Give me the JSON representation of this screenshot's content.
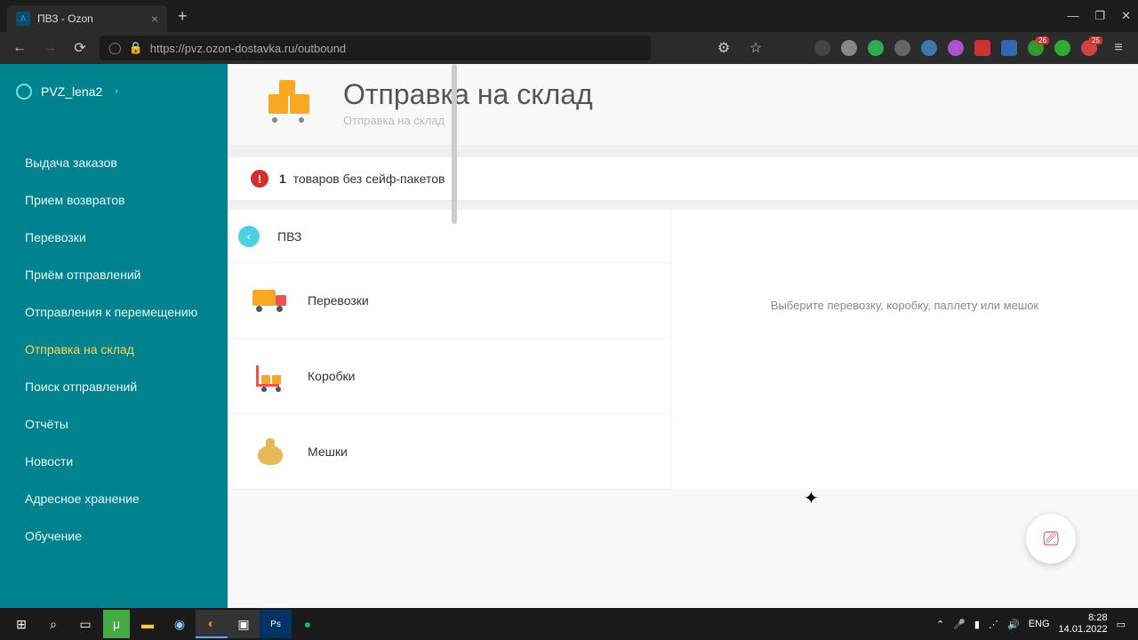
{
  "browser": {
    "tab_title": "ПВЗ - Ozon",
    "url": "https://pvz.ozon-dostavka.ru/outbound"
  },
  "sidebar": {
    "brand": "PVZ_lena2",
    "items": [
      {
        "label": "Выдача заказов",
        "active": false
      },
      {
        "label": "Прием возвратов",
        "active": false
      },
      {
        "label": "Перевозки",
        "active": false
      },
      {
        "label": "Приём отправлений",
        "active": false
      },
      {
        "label": "Отправления к перемещению",
        "active": false
      },
      {
        "label": "Отправка на склад",
        "active": true
      },
      {
        "label": "Поиск отправлений",
        "active": false
      },
      {
        "label": "Отчёты",
        "active": false
      },
      {
        "label": "Новости",
        "active": false
      },
      {
        "label": "Адресное хранение",
        "active": false
      },
      {
        "label": "Обучение",
        "active": false
      }
    ]
  },
  "page": {
    "title": "Отправка на склад",
    "subtitle": "Отправка на склад"
  },
  "alert": {
    "count": "1",
    "text": "товаров без сейф-пакетов"
  },
  "panel": {
    "back": "ПВЗ",
    "items": [
      {
        "label": "Перевозки"
      },
      {
        "label": "Коробки"
      },
      {
        "label": "Мешки"
      }
    ]
  },
  "placeholder": "Выберите перевозку, коробку, паллету или мешок",
  "taskbar": {
    "lang": "ENG",
    "time": "8:28",
    "date": "14.01.2022"
  }
}
